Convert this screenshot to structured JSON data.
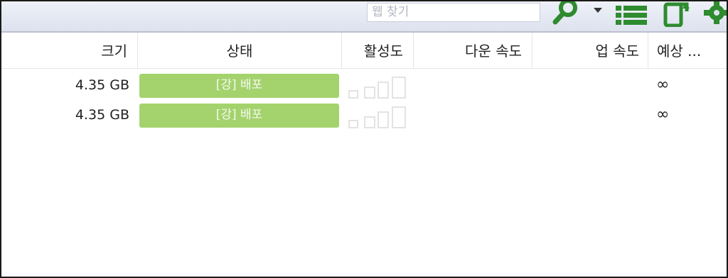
{
  "toolbar": {
    "search_placeholder": "웹 찾기",
    "icons": [
      "search-icon",
      "dropdown-arrow-icon",
      "list-view-icon",
      "remote-device-icon",
      "settings-icon"
    ],
    "accent_color": "#2e8b2e"
  },
  "columns": {
    "size": "크기",
    "status": "상태",
    "activity": "활성도",
    "down_speed": "다운 속도",
    "up_speed": "업 속도",
    "eta": "예상 ..."
  },
  "rows": [
    {
      "size": "4.35 GB",
      "status": "[강] 배포",
      "eta": "∞"
    },
    {
      "size": "4.35 GB",
      "status": "[강] 배포",
      "eta": "∞"
    }
  ],
  "status_color": "#a4d36d"
}
